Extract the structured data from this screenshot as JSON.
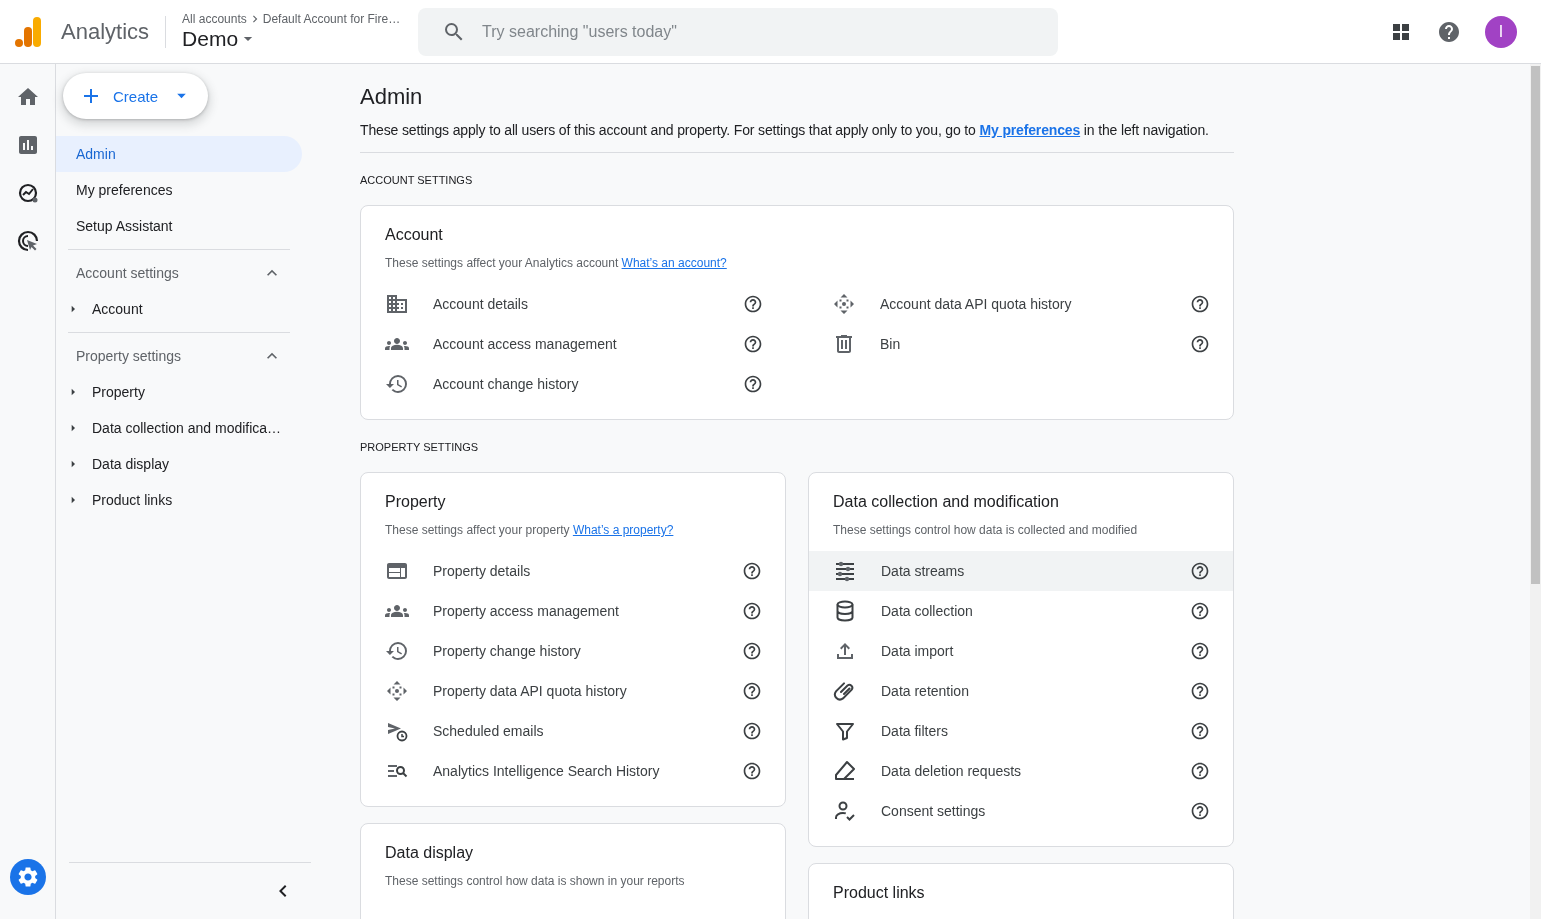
{
  "header": {
    "product": "Analytics",
    "breadcrumb": [
      "All accounts",
      "Default Account for Fire…"
    ],
    "property": "Demo",
    "search": {
      "placeholder": "Try searching \"users today\""
    },
    "avatar": "I"
  },
  "rail": {
    "top": [
      {
        "selected": false
      },
      {
        "selected": false
      },
      {
        "selected": false
      },
      {
        "selected": false
      }
    ],
    "admin": {
      "selected": true
    }
  },
  "sidebar": {
    "create": "Create",
    "items": [
      {
        "label": "Admin",
        "selected": true
      },
      {
        "label": "My preferences",
        "selected": false
      },
      {
        "label": "Setup Assistant",
        "selected": false
      }
    ],
    "sections": [
      {
        "title": "Account settings",
        "expanded": true,
        "children": [
          {
            "label": "Account",
            "expanded": false
          }
        ]
      },
      {
        "title": "Property settings",
        "expanded": true,
        "children": [
          {
            "label": "Property",
            "expanded": false
          },
          {
            "label": "Data collection and modifica…",
            "expanded": false
          },
          {
            "label": "Data display",
            "expanded": false
          },
          {
            "label": "Product links",
            "expanded": false
          }
        ]
      }
    ]
  },
  "main": {
    "title": "Admin",
    "description": {
      "before": "These settings apply to all users of this account and property. For settings that apply only to you, go to ",
      "link": "My preferences",
      "after": " in the left navigation."
    },
    "sections": [
      {
        "heading": "ACCOUNT SETTINGS",
        "cards": [
          {
            "title": "Account",
            "description": {
              "text": "These settings affect your Analytics account ",
              "link": "What’s an account?"
            },
            "columns": [
              [
                {
                  "label": "Account details",
                  "highlighted": false
                },
                {
                  "label": "Account access management",
                  "highlighted": false
                },
                {
                  "label": "Account change history",
                  "highlighted": false
                }
              ],
              [
                {
                  "label": "Account data API quota history",
                  "highlighted": false
                },
                {
                  "label": "Bin",
                  "highlighted": false
                }
              ]
            ]
          }
        ]
      },
      {
        "heading": "PROPERTY SETTINGS",
        "columns": [
          [
            {
              "title": "Property",
              "description": {
                "text": "These settings affect your property ",
                "link": "What’s a property?"
              },
              "columns": [
                [
                  {
                    "label": "Property details",
                    "highlighted": false
                  },
                  {
                    "label": "Property access management",
                    "highlighted": false
                  },
                  {
                    "label": "Property change history",
                    "highlighted": false
                  },
                  {
                    "label": "Property data API quota history",
                    "highlighted": false
                  },
                  {
                    "label": "Scheduled emails",
                    "highlighted": false
                  },
                  {
                    "label": "Analytics Intelligence Search History",
                    "highlighted": false
                  }
                ]
              ]
            },
            {
              "title": "Data display",
              "description": {
                "text": "These settings control how data is shown in your reports"
              }
            }
          ],
          [
            {
              "title": "Data collection and modification",
              "description": {
                "text": "These settings control how data is collected and modified"
              },
              "columns": [
                [
                  {
                    "label": "Data streams",
                    "highlighted": true
                  },
                  {
                    "label": "Data collection",
                    "highlighted": false
                  },
                  {
                    "label": "Data import",
                    "highlighted": false
                  },
                  {
                    "label": "Data retention",
                    "highlighted": false
                  },
                  {
                    "label": "Data filters",
                    "highlighted": false
                  },
                  {
                    "label": "Data deletion requests",
                    "highlighted": false
                  },
                  {
                    "label": "Consent settings",
                    "highlighted": false
                  }
                ]
              ]
            },
            {
              "title": "Product links"
            }
          ]
        ]
      }
    ]
  }
}
